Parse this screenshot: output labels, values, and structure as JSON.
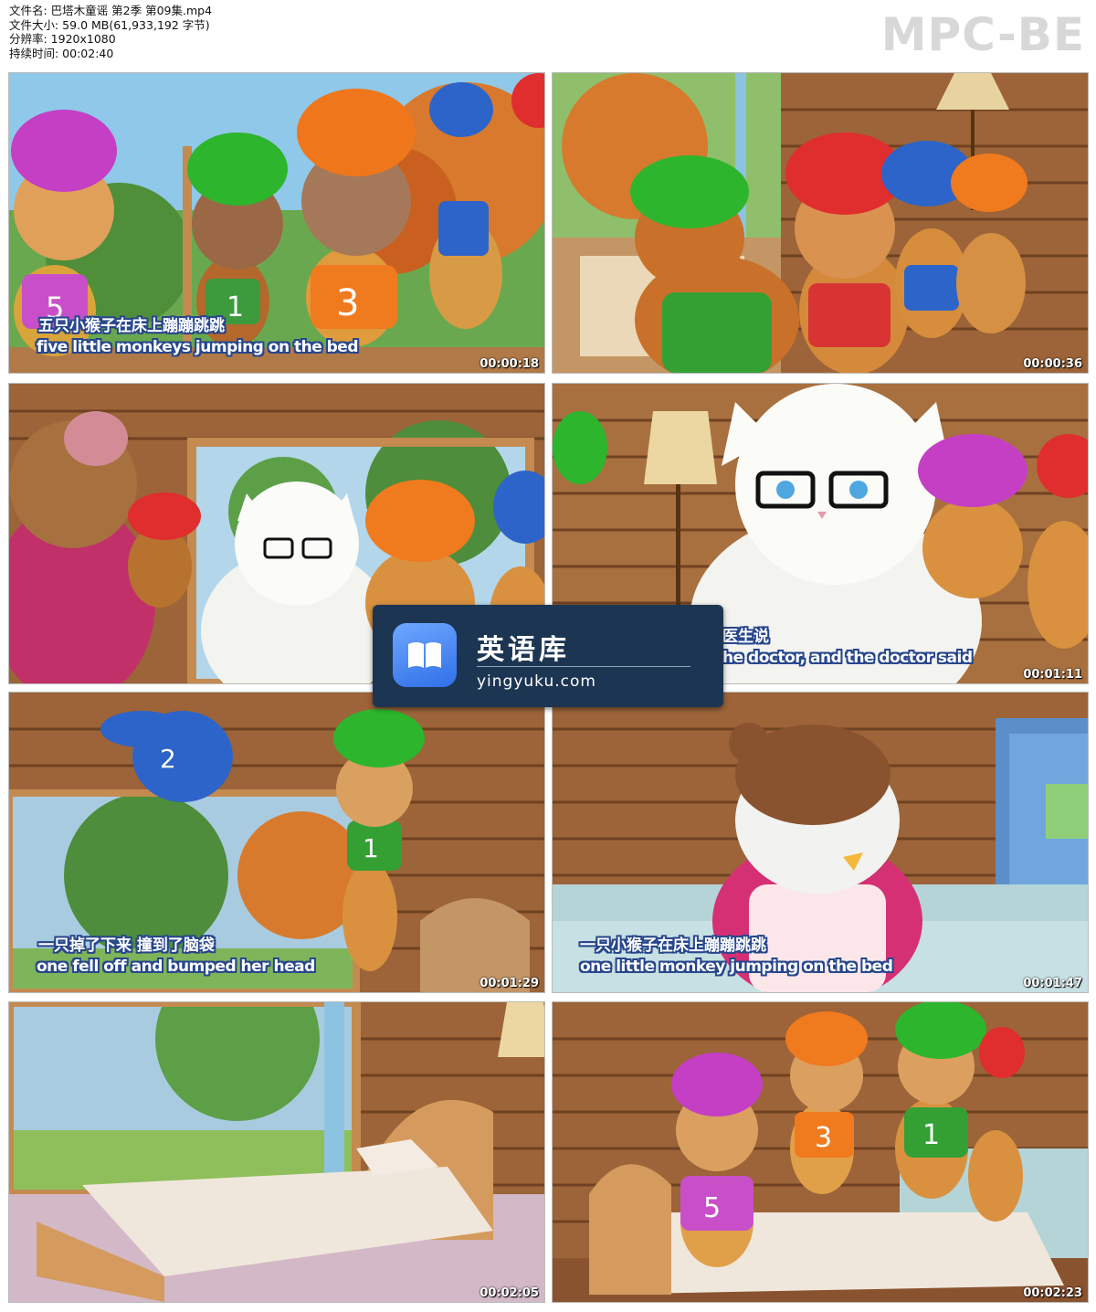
{
  "file_info": {
    "name": "文件名: 巴塔木童谣 第2季 第09集.mp4",
    "size": "文件大小: 59.0 MB(61,933,192 字节)",
    "resolution": "分辨率: 1920x1080",
    "duration": "持续时间: 00:02:40"
  },
  "brand": "MPC-BE",
  "thumbnails": [
    {
      "timestamp": "00:00:18",
      "subtitle_cn": "五只小猴子在床上蹦蹦跳跳",
      "subtitle_en": "five little monkeys jumping on the bed"
    },
    {
      "timestamp": "00:00:36",
      "subtitle_cn": "",
      "subtitle_en": ""
    },
    {
      "timestamp": "",
      "subtitle_cn": "",
      "subtitle_en": ""
    },
    {
      "timestamp": "00:01:11",
      "subtitle_cn": "医生说",
      "subtitle_en": "he doctor, and the doctor said"
    },
    {
      "timestamp": "00:01:29",
      "subtitle_cn": "一只掉了下来 撞到了脑袋",
      "subtitle_en": "one fell off and bumped her head"
    },
    {
      "timestamp": "00:01:47",
      "subtitle_cn": "一只小猴子在床上蹦蹦跳跳",
      "subtitle_en": "one little monkey jumping on the bed"
    },
    {
      "timestamp": "00:02:05",
      "subtitle_cn": "",
      "subtitle_en": ""
    },
    {
      "timestamp": "00:02:23",
      "subtitle_cn": "",
      "subtitle_en": ""
    }
  ],
  "overlay": {
    "title": "英语库",
    "url": "yingyuku.com",
    "icon": "open-book-icon"
  },
  "colors": {
    "wood": "#9c6438",
    "subtitle_outline": "#27468c",
    "overlay_bg": "#1c3552"
  }
}
